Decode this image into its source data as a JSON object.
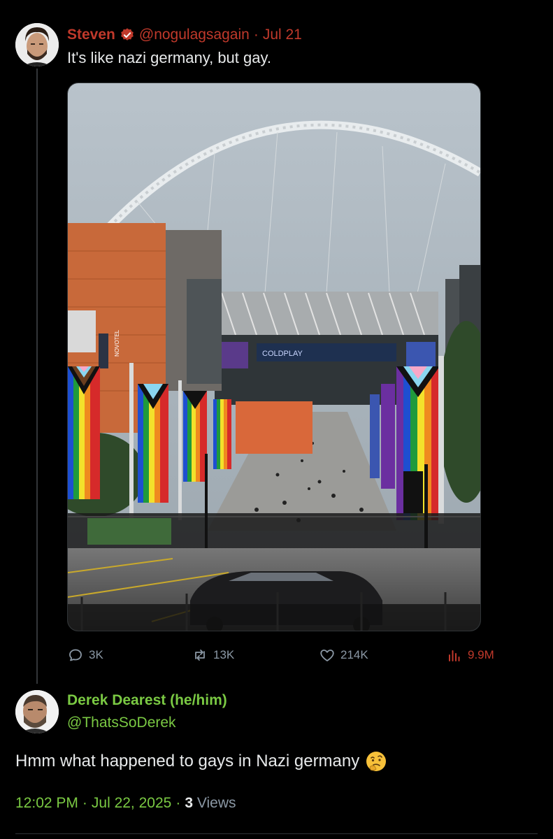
{
  "tweet": {
    "author_name": "Steven",
    "handle": "@nogulagsagain",
    "separator": "·",
    "date": "Jul 21",
    "text": "It's like nazi germany, but gay.",
    "media": {
      "scoreboard_text": "COLDPLAY",
      "hotel_sign": "NOVOTEL"
    },
    "actions": {
      "replies": "3K",
      "retweets": "13K",
      "likes": "214K",
      "views": "9.9M"
    }
  },
  "reply": {
    "author_name": "Derek Dearest (he/him)",
    "handle": "@ThatsSoDerek",
    "text": "Hmm what happened to gays in Nazi germany",
    "time": "12:02 PM",
    "separator": "·",
    "date": "Jul 22, 2025",
    "separator2": "·",
    "views_count": "3",
    "views_label": "Views"
  },
  "colors": {
    "background": "#000000",
    "author_accent": "#c0392b",
    "reply_accent": "#7ac943",
    "text_primary": "#e7e9ea",
    "text_secondary": "#8b98a5"
  },
  "icons": {
    "verified": "verified-badge-icon",
    "reply": "speech-bubble-icon",
    "retweet": "retweet-icon",
    "like": "heart-icon",
    "views": "bar-chart-icon",
    "emoji": "thinking-face-emoji"
  }
}
